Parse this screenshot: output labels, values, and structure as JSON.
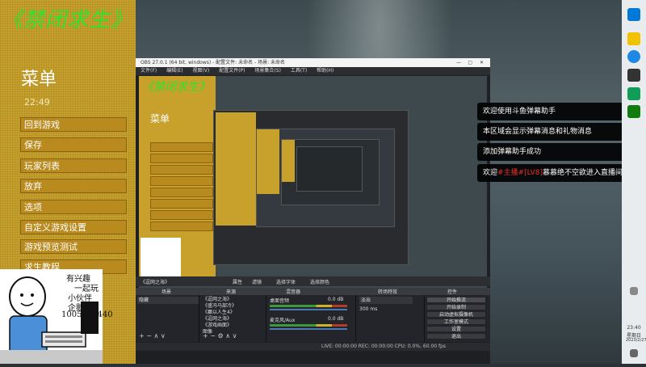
{
  "game": {
    "title": "《禁闭求生》",
    "menu_title": "菜单",
    "menu_time": "22:49",
    "menu_items": [
      "回到游戏",
      "保存",
      "玩家列表",
      "放弃",
      "选项",
      "自定义游戏设置",
      "游戏预览测试",
      "求生教程"
    ]
  },
  "webcam": {
    "lines": [
      "有兴趣",
      "一起玩",
      "小伙伴",
      "企鹅群",
      "1005195440"
    ]
  },
  "obs": {
    "title": "OBS 27.0.1 (64 bit, windows) - 配置文件: 未命名 - 场景: 未命名",
    "menus": [
      "文件(F)",
      "编辑(E)",
      "视图(V)",
      "配置文件(P)",
      "场景集合(S)",
      "工具(T)",
      "帮助(H)"
    ],
    "source_name": "《逗网之海》",
    "prop_btn": "属性",
    "filter_btn": "滤镜",
    "dock_bar_items": [
      "选择字体",
      "选择颜色"
    ],
    "dock_titles": [
      "场景",
      "来源",
      "混音器",
      "转场特效",
      "控件"
    ],
    "scene_item": "隐藏",
    "sources": [
      "《逗网之海》",
      "《盛冯马部冷》",
      "《癫以人生4》",
      "《逗网之海》",
      "《游戏画面》",
      "图像"
    ],
    "mixer": [
      {
        "name": "桌面音频",
        "db": "0.0 dB"
      },
      {
        "name": "麦克风/Aux",
        "db": "0.0 dB"
      }
    ],
    "transition_value": "淡出",
    "transition_duration": "300 ms",
    "controls": [
      "开始推流",
      "开始录制",
      "启动虚拟摄像机",
      "工作室模式",
      "设置",
      "退出"
    ],
    "status": "LIVE: 00:00:00   REC: 00:00:00   CPU: 0.0%, 60.00 fps"
  },
  "notifications": [
    {
      "text": "欢迎使用斗鱼弹幕助手"
    },
    {
      "text": "本区域会显示弹幕消息和礼物消息"
    },
    {
      "text": "添加弹幕助手成功"
    },
    {
      "pre": "欢迎",
      "user": "#主播#",
      "level": "[LV8]",
      "post": "慕慕绝不空欲进入直播间"
    }
  ],
  "taskbar": {
    "time": "23:40",
    "weekday": "星期日",
    "date": "2023/2/27"
  }
}
